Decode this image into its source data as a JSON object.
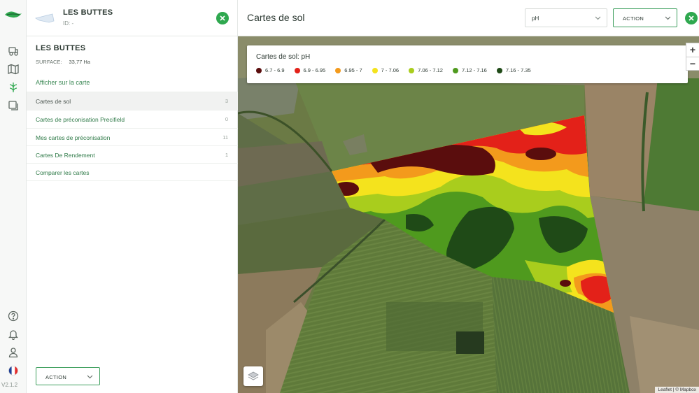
{
  "colors": {
    "accent": "#2fa84f",
    "link": "#2f7a48"
  },
  "sidebar": {
    "version": "V2.1.2"
  },
  "panel": {
    "farm_name": "LES BUTTES",
    "farm_id": "ID: -",
    "field_title": "LES BUTTES",
    "surface_label": "SURFACE:",
    "surface_value": "33,77 Ha",
    "show_on_map": "Afficher sur la carte",
    "nav": [
      {
        "label": "Cartes de sol",
        "count": "3"
      },
      {
        "label": "Cartes de préconisation Precifield",
        "count": "0"
      },
      {
        "label": "Mes cartes de préconisation",
        "count": "11"
      },
      {
        "label": "Cartes De Rendement",
        "count": "1"
      },
      {
        "label": "Comparer les cartes",
        "count": ""
      }
    ],
    "action_label": "ACTION"
  },
  "main": {
    "title": "Cartes de sol",
    "select_value": "pH",
    "action_label": "ACTION"
  },
  "map": {
    "legend_title": "Cartes de sol: pH",
    "legend": [
      {
        "label": "6.7 - 6.9",
        "color": "#5a0d0d"
      },
      {
        "label": "6.9 - 6.95",
        "color": "#e32119"
      },
      {
        "label": "6.95 - 7",
        "color": "#f39a1c"
      },
      {
        "label": "7 - 7.06",
        "color": "#f4e31d"
      },
      {
        "label": "7.06 - 7.12",
        "color": "#a9cd1d"
      },
      {
        "label": "7.12 - 7.16",
        "color": "#4f9a1e"
      },
      {
        "label": "7.16 - 7.35",
        "color": "#1f4a17"
      }
    ],
    "zoom_in": "+",
    "zoom_out": "−",
    "attribution": "Leaflet | © Mapbox"
  }
}
